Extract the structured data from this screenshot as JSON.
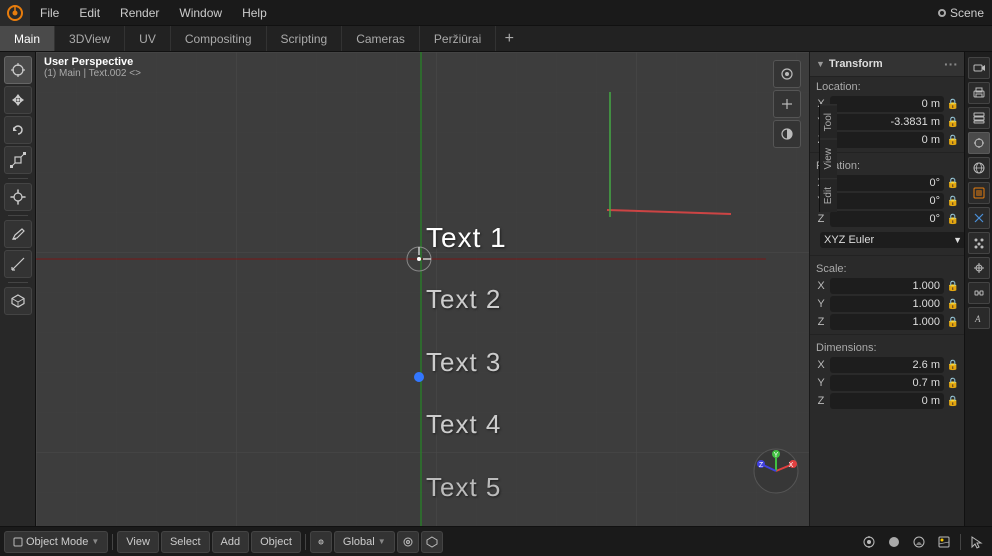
{
  "app": {
    "title": "Blender"
  },
  "top_menu": {
    "items": [
      "File",
      "Edit",
      "Render",
      "Window",
      "Help"
    ]
  },
  "workspace_tabs": {
    "tabs": [
      "Main",
      "3DView",
      "UV",
      "Compositing",
      "Scripting",
      "Cameras",
      "Peržiūrai"
    ],
    "active": "Main",
    "add_label": "+"
  },
  "scene": {
    "name": "Scene"
  },
  "viewport": {
    "header_line1": "User Perspective",
    "header_line2": "(1) Main | Text.002 <>"
  },
  "text_objects": [
    {
      "label": "Text 1",
      "active": true
    },
    {
      "label": "Text 2",
      "active": false
    },
    {
      "label": "Text 3",
      "active": false
    },
    {
      "label": "Text 4",
      "active": false
    },
    {
      "label": "Text 5",
      "active": false
    }
  ],
  "side_tabs": [
    "Tool",
    "View",
    "Edit"
  ],
  "transform_panel": {
    "title": "Transform",
    "location": {
      "label": "Location:",
      "x": {
        "label": "X",
        "value": "0 m"
      },
      "y": {
        "label": "Y",
        "value": "-3.3831 m"
      },
      "z": {
        "label": "Z",
        "value": "0 m"
      }
    },
    "rotation": {
      "label": "Rotation:",
      "x": {
        "label": "X",
        "value": "0°"
      },
      "y": {
        "label": "Y",
        "value": "0°"
      },
      "z": {
        "label": "Z",
        "value": "0°"
      }
    },
    "euler": {
      "value": "XYZ Euler"
    },
    "scale": {
      "label": "Scale:",
      "x": {
        "label": "X",
        "value": "1.000"
      },
      "y": {
        "label": "Y",
        "value": "1.000"
      },
      "z": {
        "label": "Z",
        "value": "1.000"
      }
    },
    "dimensions": {
      "label": "Dimensions:",
      "x": {
        "label": "X",
        "value": "2.6 m"
      },
      "y": {
        "label": "Y",
        "value": "0.7 m"
      },
      "z": {
        "label": "Z",
        "value": "0 m"
      }
    }
  },
  "bottom_bar": {
    "object_mode": "Object Mode",
    "view": "View",
    "select": "Select",
    "add": "Add",
    "object": "Object",
    "transform": "Global"
  },
  "prop_panel_icons": [
    "⬛",
    "🔴",
    "🟠",
    "🟡",
    "🔵",
    "⚙",
    "🔗",
    "📷",
    "✨",
    "🖼",
    "💧"
  ]
}
